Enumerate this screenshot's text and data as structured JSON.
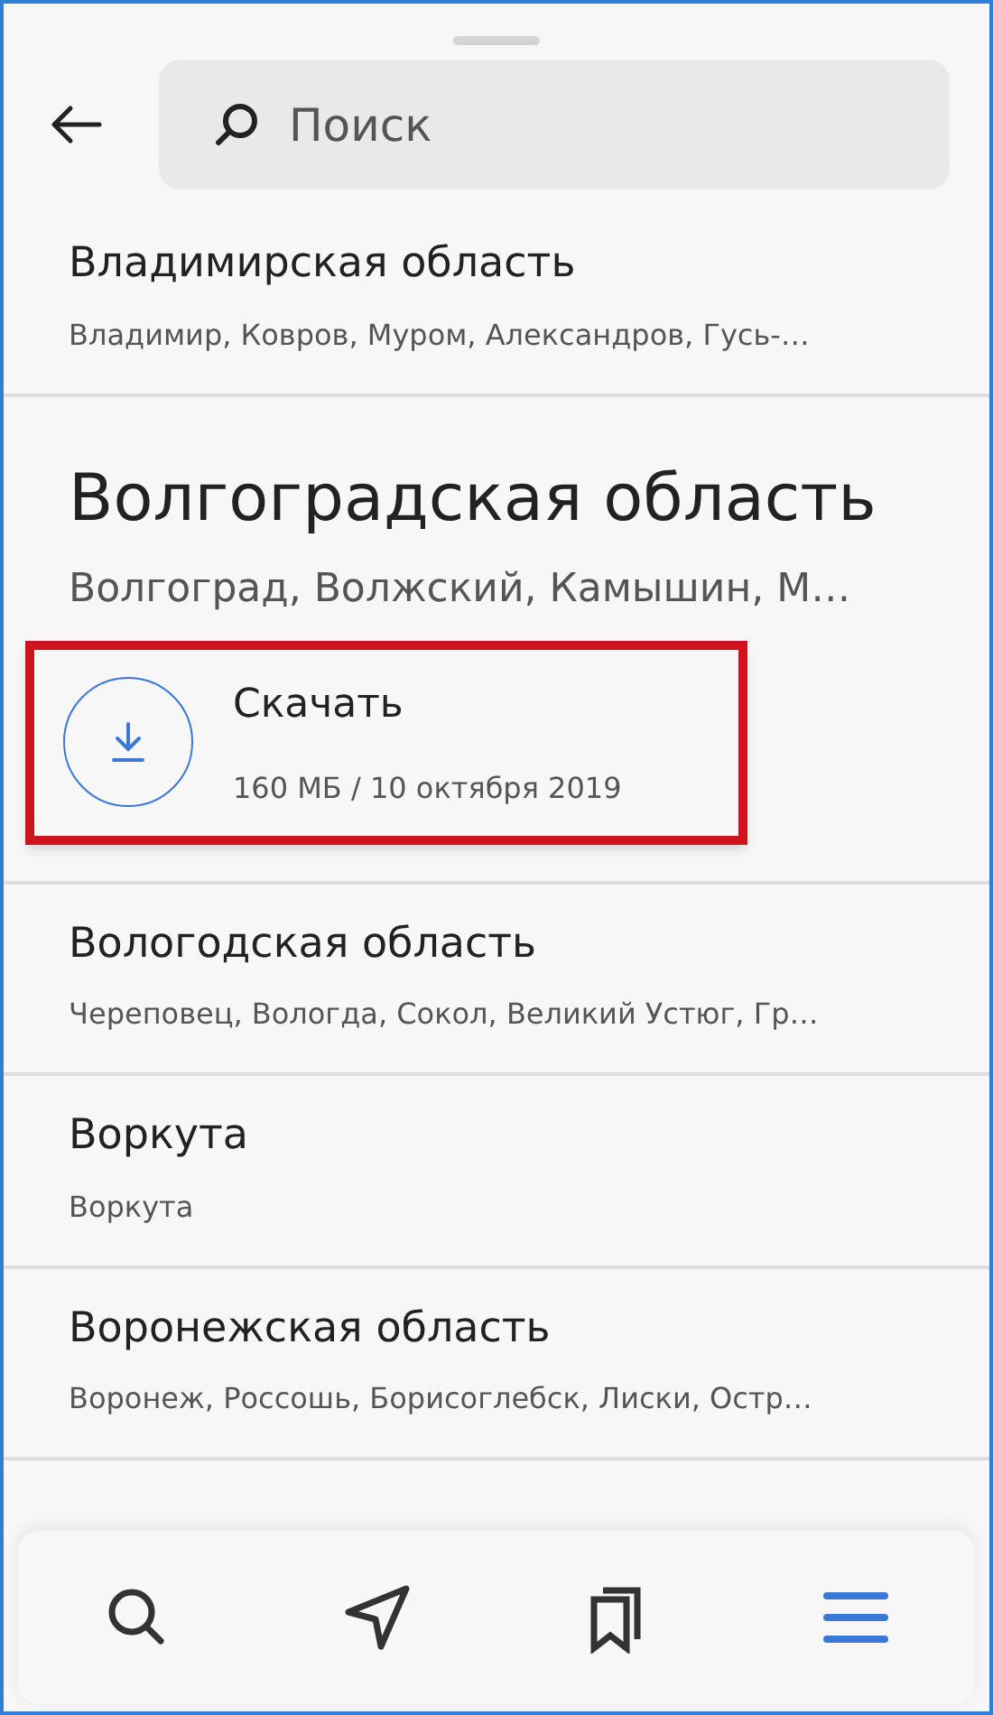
{
  "search": {
    "placeholder": "Поиск"
  },
  "regions": [
    {
      "title": "Владимирская область",
      "cities": "Владимир, Ковров, Муром, Александров, Гусь-…",
      "expanded": false
    },
    {
      "title": "Волгоградская область",
      "cities": "Волгоград, Волжский, Камышин, М…",
      "expanded": true,
      "download": {
        "label": "Скачать",
        "info": "160 МБ / 10 октября 2019",
        "highlighted": true
      }
    },
    {
      "title": "Вологодская область",
      "cities": "Череповец, Вологда, Сокол, Великий Устюг, Гр…",
      "expanded": false
    },
    {
      "title": "Воркута",
      "cities": "Воркута",
      "expanded": false
    },
    {
      "title": "Воронежская область",
      "cities": "Воронеж, Россошь, Борисоглебск, Лиски, Остр…",
      "expanded": false
    }
  ],
  "nav": [
    {
      "kind": "search",
      "selected": false
    },
    {
      "kind": "route",
      "selected": false
    },
    {
      "kind": "bookmarks",
      "selected": false
    },
    {
      "kind": "menu",
      "selected": true
    }
  ]
}
